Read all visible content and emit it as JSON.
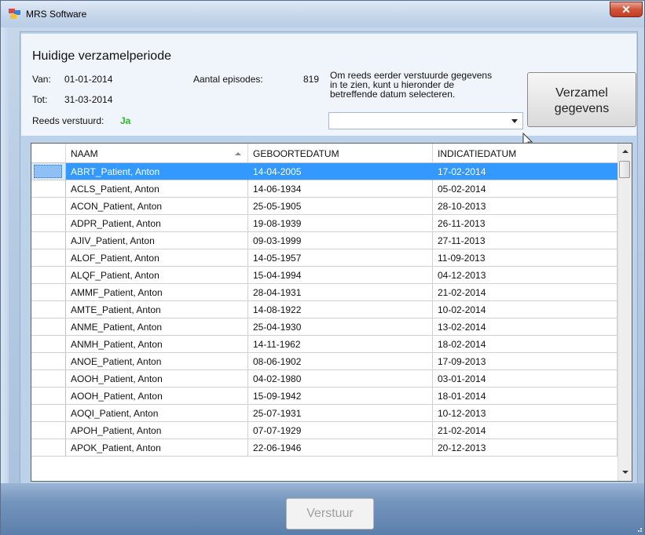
{
  "window": {
    "title": "MRS Software",
    "close_glyph": "✕"
  },
  "header": {
    "heading": "Huidige verzamelperiode",
    "van_label": "Van:",
    "van_value": "01-01-2014",
    "tot_label": "Tot:",
    "tot_value": "31-03-2014",
    "reeds_label": "Reeds verstuurd:",
    "reeds_value": "Ja",
    "episodes_label": "Aantal episodes:",
    "episodes_value": "819",
    "info_line1": "Om reeds eerder verstuurde gegevens",
    "info_line2": "in te zien, kunt u hieronder de",
    "info_line3": "betreffende datum selecteren.",
    "combo_value": "",
    "verzamel_line1": "Verzamel",
    "verzamel_line2": "gegevens"
  },
  "grid": {
    "columns": [
      "NAAM",
      "GEBOORTEDATUM",
      "INDICATIEDATUM"
    ],
    "sorted_column": "NAAM",
    "selected_row": 0,
    "rows": [
      [
        "ABRT_Patient, Anton",
        "14-04-2005",
        "17-02-2014"
      ],
      [
        "ACLS_Patient, Anton",
        "14-06-1934",
        "05-02-2014"
      ],
      [
        "ACON_Patient, Anton",
        "25-05-1905",
        "28-10-2013"
      ],
      [
        "ADPR_Patient, Anton",
        "19-08-1939",
        "26-11-2013"
      ],
      [
        "AJIV_Patient, Anton",
        "09-03-1999",
        "27-11-2013"
      ],
      [
        "ALOF_Patient, Anton",
        "14-05-1957",
        "11-09-2013"
      ],
      [
        "ALQF_Patient, Anton",
        "15-04-1994",
        "04-12-2013"
      ],
      [
        "AMMF_Patient, Anton",
        "28-04-1931",
        "21-02-2014"
      ],
      [
        "AMTE_Patient, Anton",
        "14-08-1922",
        "10-02-2014"
      ],
      [
        "ANME_Patient, Anton",
        "25-04-1930",
        "13-02-2014"
      ],
      [
        "ANMH_Patient, Anton",
        "14-11-1962",
        "18-02-2014"
      ],
      [
        "ANOE_Patient, Anton",
        "08-06-1902",
        "17-09-2013"
      ],
      [
        "AOOH_Patient, Anton",
        "04-02-1980",
        "03-01-2014"
      ],
      [
        "AOOH_Patient, Anton",
        "15-09-1942",
        "18-01-2014"
      ],
      [
        "AOQI_Patient, Anton",
        "25-07-1931",
        "10-12-2013"
      ],
      [
        "APOH_Patient, Anton",
        "07-07-1929",
        "21-02-2014"
      ],
      [
        "APOK_Patient, Anton",
        "22-06-1946",
        "20-12-2013"
      ]
    ]
  },
  "footer": {
    "verstuur_label": "Verstuur"
  },
  "colors": {
    "selection": "#3399ff",
    "ja": "#2eb82e",
    "footer": "#5c7fab"
  }
}
